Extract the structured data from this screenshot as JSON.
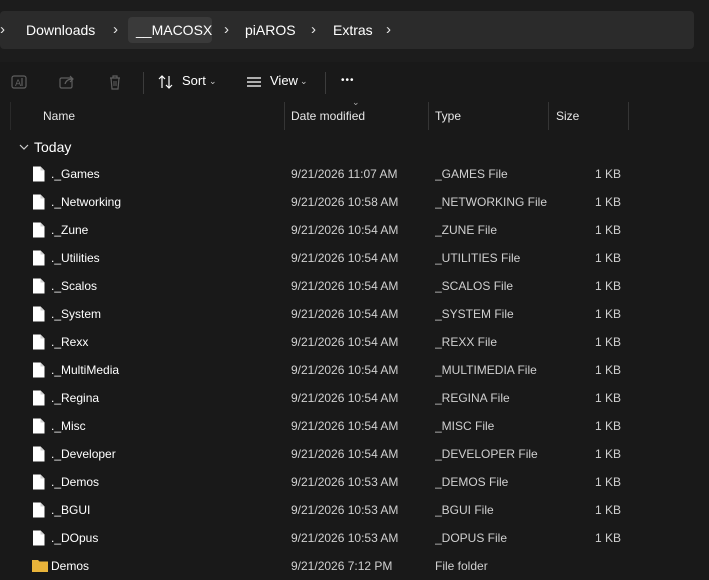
{
  "breadcrumb": {
    "items": [
      "Downloads",
      "__MACOSX",
      "piAROS",
      "Extras"
    ],
    "separator": "›"
  },
  "toolbar": {
    "sort_label": "Sort",
    "view_label": "View",
    "more_label": "•••"
  },
  "columns": {
    "name": "Name",
    "date": "Date modified",
    "type": "Type",
    "size": "Size"
  },
  "group": {
    "label": "Today"
  },
  "files": [
    {
      "name": "._Games",
      "date": "9/21/2026 11:07 AM",
      "type": "_GAMES File",
      "size": "1 KB"
    },
    {
      "name": "._Networking",
      "date": "9/21/2026 10:58 AM",
      "type": "_NETWORKING File",
      "size": "1 KB"
    },
    {
      "name": "._Zune",
      "date": "9/21/2026 10:54 AM",
      "type": "_ZUNE File",
      "size": "1 KB"
    },
    {
      "name": "._Utilities",
      "date": "9/21/2026 10:54 AM",
      "type": "_UTILITIES File",
      "size": "1 KB"
    },
    {
      "name": "._Scalos",
      "date": "9/21/2026 10:54 AM",
      "type": "_SCALOS File",
      "size": "1 KB"
    },
    {
      "name": "._System",
      "date": "9/21/2026 10:54 AM",
      "type": "_SYSTEM File",
      "size": "1 KB"
    },
    {
      "name": "._Rexx",
      "date": "9/21/2026 10:54 AM",
      "type": "_REXX File",
      "size": "1 KB"
    },
    {
      "name": "._MultiMedia",
      "date": "9/21/2026 10:54 AM",
      "type": "_MULTIMEDIA File",
      "size": "1 KB"
    },
    {
      "name": "._Regina",
      "date": "9/21/2026 10:54 AM",
      "type": "_REGINA File",
      "size": "1 KB"
    },
    {
      "name": "._Misc",
      "date": "9/21/2026 10:54 AM",
      "type": "_MISC File",
      "size": "1 KB"
    },
    {
      "name": "._Developer",
      "date": "9/21/2026 10:54 AM",
      "type": "_DEVELOPER File",
      "size": "1 KB"
    },
    {
      "name": "._Demos",
      "date": "9/21/2026 10:53 AM",
      "type": "_DEMOS File",
      "size": "1 KB"
    },
    {
      "name": "._BGUI",
      "date": "9/21/2026 10:53 AM",
      "type": "_BGUI File",
      "size": "1 KB"
    },
    {
      "name": "._DOpus",
      "date": "9/21/2026 10:53 AM",
      "type": "_DOPUS File",
      "size": "1 KB"
    },
    {
      "name": "Demos",
      "date": "9/21/2026 7:12 PM",
      "type": "File folder",
      "size": "",
      "is_folder": true
    }
  ],
  "colors": {
    "background": "#191919",
    "address_bar": "#2b2b2b",
    "folder_icon": "#e8b33a",
    "file_icon": "#ffffff"
  }
}
